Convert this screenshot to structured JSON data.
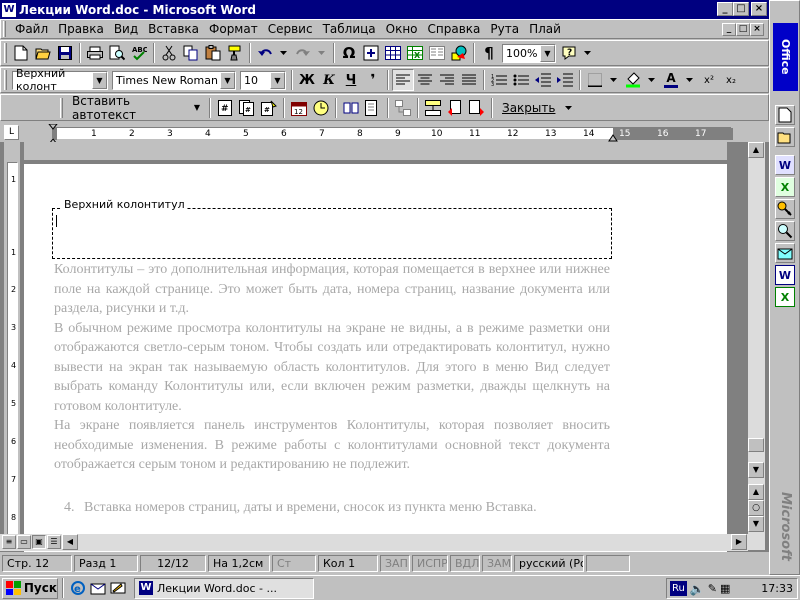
{
  "window": {
    "title": "Лекции Word.doc - Microsoft Word",
    "app_icon": "word-icon",
    "caption_buttons": {
      "minimize": "_",
      "maximize": "□",
      "close": "×"
    }
  },
  "menu": {
    "items": [
      "Файл",
      "Правка",
      "Вид",
      "Вставка",
      "Формат",
      "Сервис",
      "Таблица",
      "Окно",
      "Справка",
      "Рута",
      "Плай"
    ]
  },
  "toolbar_standard": {
    "zoom": "100%",
    "icons": [
      "new-icon",
      "open-icon",
      "save-icon",
      "print-icon",
      "preview-icon",
      "spelling-icon",
      "cut-icon",
      "copy-icon",
      "paste-icon",
      "format-painter-icon",
      "undo-icon",
      "redo-icon",
      "symbol-icon",
      "table-icon",
      "excel-icon",
      "columns-icon",
      "drawing-icon",
      "show-all-icon",
      "help-icon"
    ]
  },
  "toolbar_formatting": {
    "style": "Верхний колонт",
    "font": "Times New Roman",
    "size": "10",
    "bold": "Ж",
    "italic": "К",
    "underline": "Ч",
    "font_color_label": "A",
    "superscript": "x²",
    "subscript": "x₂"
  },
  "toolbar_header": {
    "insert_autotext": "Вставить автотекст",
    "close": "Закрыть"
  },
  "ruler": {
    "numbers": [
      "1",
      "2",
      "3",
      "4",
      "5",
      "6",
      "7",
      "8",
      "9",
      "10",
      "11",
      "12",
      "13",
      "14",
      "15",
      "16",
      "17"
    ],
    "vnumbers": [
      "1",
      "1",
      "2",
      "3",
      "4",
      "5",
      "6",
      "7",
      "8"
    ]
  },
  "document": {
    "header_label": "Верхний колонтитул",
    "paragraphs": [
      "Колонтитулы – это дополнительная информация, которая помещается в верхнее или нижнее поле на каждой странице. Это может быть дата, номера страниц, название документа или раздела, рисунки и т.д.",
      "В обычном режиме просмотра колонтитулы на экране не видны, а в режиме разметки они отображаются светло-серым тоном. Чтобы создать или отредактировать колонтитул, нужно вывести на экран так называемую область колонтитулов. Для этого в меню Вид следует выбрать команду Колонтитулы или, если включен режим разметки, дважды щелкнуть на готовом колонтитуле.",
      "На экране появляется панель инструментов Колонтитулы, которая позволяет вносить необходимые изменения. В режиме работы с колонтитулами основной текст документа отображается серым тоном и редактированию не подлежит."
    ],
    "list_item_number": "4.",
    "list_item_text": "Вставка номеров страниц, даты и времени, сносок из пункта меню Вставка."
  },
  "statusbar": {
    "page": "Стр. 12",
    "section": "Разд 1",
    "pages": "12/12",
    "at": "На 1,2см",
    "line": "Ст",
    "col": "Кол 1",
    "rec": "ЗАП",
    "trk": "ИСПР",
    "ext": "ВДЛ",
    "ovr": "ЗАМ",
    "language": "русский (Ро"
  },
  "officebar": {
    "logo": "Office",
    "brand": "Microsoft"
  },
  "taskbar": {
    "start": "Пуск",
    "task_word": "Лекции Word.doc - ...",
    "lang": "Ru",
    "clock": "17:33"
  }
}
